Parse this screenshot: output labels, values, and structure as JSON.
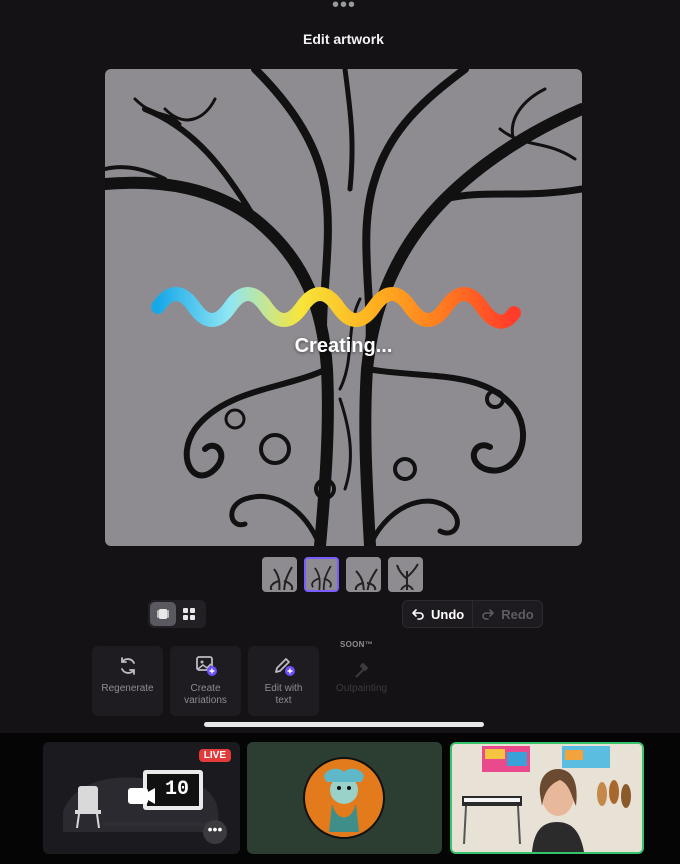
{
  "app": {
    "title": "Edit artwork",
    "top_menu_icon": "ellipsis-icon"
  },
  "canvas": {
    "status_text": "Creating..."
  },
  "thumbnails": {
    "count": 4,
    "selected_index": 1
  },
  "view_toggle": {
    "options": [
      "single-view-icon",
      "grid-view-icon"
    ],
    "active": "single-view-icon"
  },
  "history": {
    "undo_label": "Undo",
    "redo_label": "Redo"
  },
  "tools": [
    {
      "label": "Regenerate",
      "icon": "refresh-icon",
      "enabled": true
    },
    {
      "label": "Create variations",
      "icon": "image-plus-icon",
      "enabled": true
    },
    {
      "label": "Edit with text",
      "icon": "pen-plus-icon",
      "enabled": true
    },
    {
      "label": "Outpainting",
      "icon": "wand-icon",
      "enabled": false,
      "badge": "SOON™"
    }
  ],
  "participants": [
    {
      "type": "scene",
      "badge": "LIVE",
      "countdown": "10"
    },
    {
      "type": "avatar"
    },
    {
      "type": "camera",
      "active_speaker": true
    }
  ],
  "colors": {
    "accent": "#7c5cff",
    "live": "#e23b3b",
    "speaker_border": "#35c46b"
  }
}
